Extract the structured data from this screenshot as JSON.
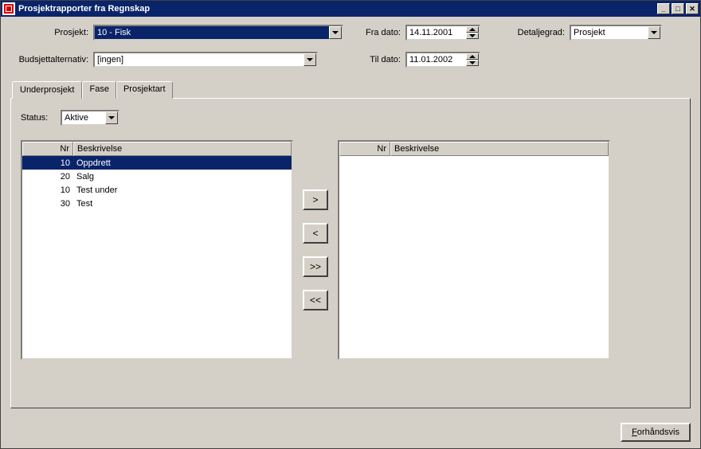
{
  "window": {
    "title": "Prosjektrapporter fra Regnskap"
  },
  "labels": {
    "prosjekt": "Prosjekt:",
    "budsjett": "Budsjettalternativ:",
    "fradato": "Fra dato:",
    "tildato": "Til dato:",
    "detalj": "Detaljegrad:",
    "status": "Status:"
  },
  "fields": {
    "prosjekt": "10 - Fisk",
    "budsjett": "[ingen]",
    "fradato": "14.11.2001",
    "tildato": "11.01.2002",
    "detalj": "Prosjekt",
    "status": "Aktive"
  },
  "tabs": {
    "underprosjekt": "Underprosjekt",
    "fase": "Fase",
    "prosjektart": "Prosjektart"
  },
  "list_headers": {
    "nr": "Nr",
    "besk": "Beskrivelse"
  },
  "left_list": [
    {
      "nr": "10",
      "besk": "Oppdrett",
      "selected": true
    },
    {
      "nr": "20",
      "besk": "Salg",
      "selected": false
    },
    {
      "nr": "10",
      "besk": "Test under",
      "selected": false
    },
    {
      "nr": "30",
      "besk": "Test",
      "selected": false
    }
  ],
  "right_list": [],
  "transfer": {
    "right": ">",
    "left": "<",
    "allright": ">>",
    "allleft": "<<"
  },
  "buttons": {
    "preview_first": "F",
    "preview_rest": "orhåndsvis"
  }
}
